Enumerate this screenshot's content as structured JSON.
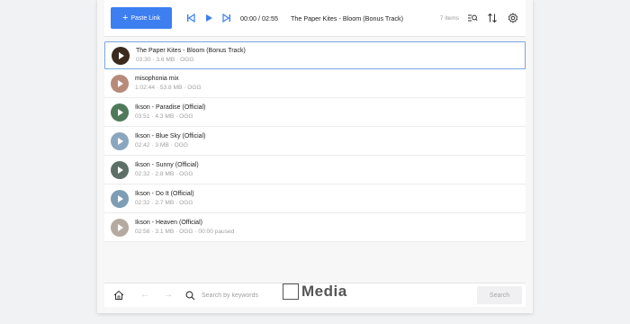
{
  "toolbar": {
    "paste_label": "Paste Link",
    "time": "00:00 / 02:55",
    "now_playing": "The Paper Kites - Bloom (Bonus Track)",
    "count": "7 items"
  },
  "tracks": [
    {
      "title": "The Paper Kites - Bloom (Bonus Track)",
      "meta": "03:30 · 3.6 MB · OGG",
      "thumb": "#3b2a1f",
      "active": true
    },
    {
      "title": "misophonia mix",
      "meta": "1:02:44 · 53.8 MB · OGG",
      "thumb": "#b88a7a"
    },
    {
      "title": "Ikson - Paradise (Official)",
      "meta": "03:51 · 4.3 MB · OGG",
      "thumb": "#4f7a5a"
    },
    {
      "title": "Ikson - Blue Sky (Official)",
      "meta": "02:42 · 3 MB · OGG",
      "thumb": "#8aa6bf"
    },
    {
      "title": "Ikson - Sunny (Official)",
      "meta": "02:32 · 2.8 MB · OGG",
      "thumb": "#5c7068"
    },
    {
      "title": "Ikson - Do It (Official)",
      "meta": "02:32 · 2.7 MB · OGG",
      "thumb": "#7d9db4"
    },
    {
      "title": "Ikson - Heaven (Official)",
      "meta": "02:56 · 3.1 MB · OGG · 00:00 paused",
      "thumb": "#b6aaa0"
    }
  ],
  "bottom": {
    "search_placeholder": "Search by keywords",
    "search_button": "Search"
  },
  "watermark": {
    "text": "Media"
  },
  "colors": {
    "accent": "#3d7ef0",
    "active_border": "#7aa6e0"
  }
}
